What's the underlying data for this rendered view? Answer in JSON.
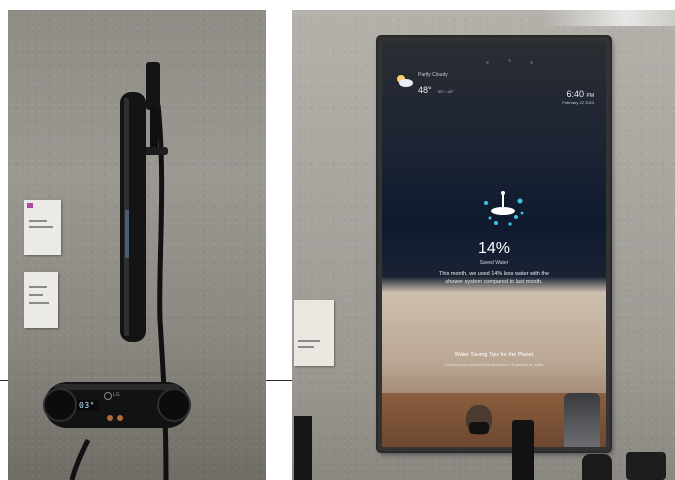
{
  "mirror": {
    "weather": {
      "icon": "cloud-sun-icon",
      "condition": "Partly Cloudy",
      "temperature": "48°",
      "range": "50° / 43°"
    },
    "clock": {
      "time": "6:40",
      "meridiem": "PM",
      "date": "February 22 2023"
    },
    "water": {
      "icon": "shower-icon",
      "percent": "14%",
      "label": "Saved Water",
      "message_line1": "This month, we used 14% less water with the",
      "message_line2": "shower system compared to last month."
    },
    "tips": {
      "title": "Water Saving Tips for the Planet",
      "subtitle": "Reduce your shower time and save 2.5 gallons of water"
    }
  },
  "shower": {
    "display_value": "03°",
    "brand": "LG"
  },
  "colors": {
    "wall_left": "#9b9892",
    "wall_right": "#a8a59f",
    "fixture_black": "#141414",
    "display_cyan": "#bfe6ff",
    "valve_copper": "#b26a3a",
    "card_accent": "#b04aa0"
  }
}
